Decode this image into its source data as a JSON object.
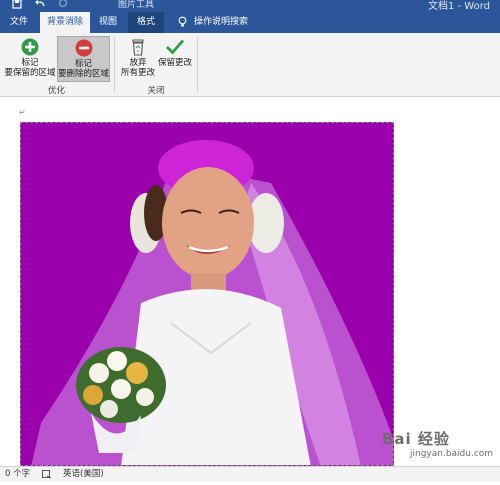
{
  "titlebar": {
    "doc_title": "文档1 - Word",
    "tool_context": "图片工具"
  },
  "tabs": [
    {
      "label": "文件",
      "active": false
    },
    {
      "label": "背景消除",
      "active": true
    },
    {
      "label": "视图",
      "active": false
    },
    {
      "label": "格式",
      "active": false
    }
  ],
  "search": {
    "label": "操作说明搜索"
  },
  "ribbon": {
    "mark_keep": {
      "line1": "标记",
      "line2": "要保留的区域"
    },
    "mark_remove": {
      "line1": "标记",
      "line2": "要删除的区域"
    },
    "group_optimize": "优化",
    "discard": {
      "line1": "放弃",
      "line2": "所有更改"
    },
    "keep_changes": {
      "line1": "保留更改"
    },
    "group_close": "关闭"
  },
  "document": {
    "paragraph_mark": "↵",
    "image_overlay_color": "#9b00ad"
  },
  "statusbar": {
    "word_count": "0 个字",
    "language": "英语(美国)"
  },
  "watermark": {
    "main": "Bai 经验",
    "sub": "jingyan.baidu.com"
  },
  "colors": {
    "accent": "#2b579a",
    "keep_green": "#2e9b45",
    "remove_red": "#d23c3c"
  }
}
